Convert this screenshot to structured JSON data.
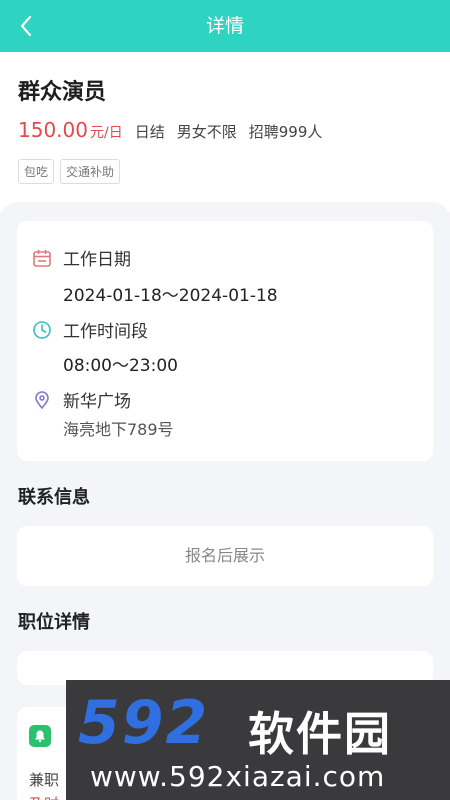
{
  "header": {
    "title": "详情"
  },
  "job": {
    "title": "群众演员",
    "pay_amount": "150.00",
    "pay_unit": "元/日",
    "settlement": "日结",
    "gender": "男女不限",
    "recruit": "招聘999人",
    "tags": [
      "包吃",
      "交通补助"
    ]
  },
  "info": {
    "date_label": "工作日期",
    "date_value": "2024-01-18～2024-01-18",
    "time_label": "工作时间段",
    "time_value": "08:00～23:00",
    "location_name": "新华广场",
    "location_address": "海亮地下789号"
  },
  "contact": {
    "title": "联系信息",
    "placeholder": "报名后展示"
  },
  "details": {
    "title": "职位详情"
  },
  "notice": {
    "line1": "兼职",
    "line2": "及时"
  },
  "watermark": {
    "logo": "592",
    "brand": "软件园",
    "url": "www.592xiazai.com"
  },
  "colors": {
    "accent": "#2ed3c2",
    "price": "#e04b4b",
    "bell": "#2cc16f"
  }
}
